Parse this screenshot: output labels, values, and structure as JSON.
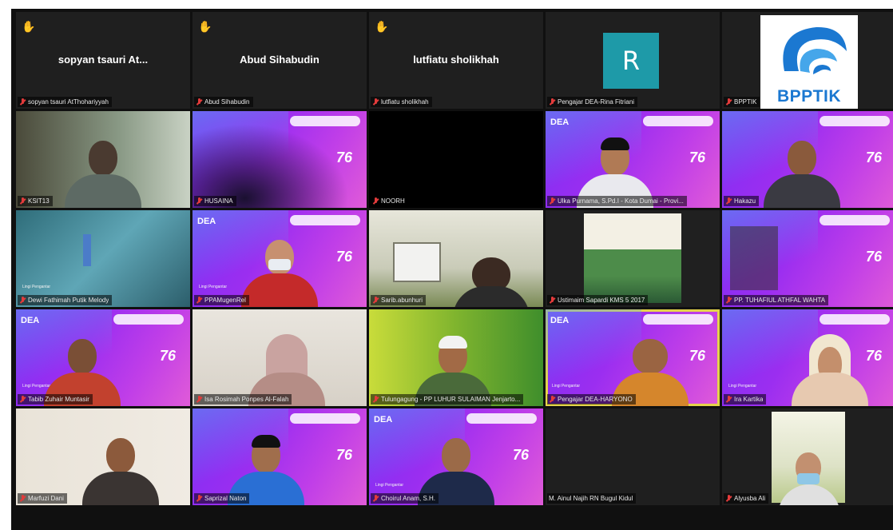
{
  "top_tiles": [
    {
      "display_name": "sopyan tsauri At...",
      "bar_name": "sopyan tsauri AtThohariyyah"
    },
    {
      "display_name": "Abud Sihabudin",
      "bar_name": "Abud Sihabudin"
    },
    {
      "display_name": "lutfiatu sholikhah",
      "bar_name": "lutfiatu sholikhah"
    },
    {
      "avatar_letter": "R",
      "bar_name": "Pengajar DEA-Rina Fitriani"
    },
    {
      "logo_text": "BPPTIK",
      "bar_name": "BPPTIK"
    }
  ],
  "tiles": [
    {
      "bar_name": "KSIT13"
    },
    {
      "bar_name": "HUSAINA"
    },
    {
      "bar_name": "NOORH"
    },
    {
      "bar_name": "Ulka Purnama, S.Pd.I - Kota Dumai - Provi..."
    },
    {
      "bar_name": "Hakazu"
    },
    {
      "bar_name": "Dewi Fathimah Putik Melody"
    },
    {
      "bar_name": "PPAMugenRel"
    },
    {
      "bar_name": "Sarib.abunhuri"
    },
    {
      "bar_name": "Ustimaim Sapardi KMS 5 2017"
    },
    {
      "bar_name": "PP. TUHAFIUL ATHFAL WAHTA"
    },
    {
      "bar_name": "Tabib Zuhair Muntasir"
    },
    {
      "bar_name": "Isa Rosimah Ponpes Al-Falah"
    },
    {
      "bar_name": "Tulungagung - PP LUHUR SULAIMAN Jenjarto..."
    },
    {
      "bar_name": "Pengajar DEA-HARYONO"
    },
    {
      "bar_name": "Ira Kartika"
    },
    {
      "bar_name": "Marfuzi Dani"
    },
    {
      "bar_name": "Saprizal Naton"
    },
    {
      "bar_name": "Choirul Anam, S.H."
    },
    {
      "bar_name": "M. Ainul Najih RN Bugul Kidul"
    },
    {
      "bar_name": "Alyusba Ali"
    }
  ],
  "virtual_bg": {
    "brand": "DEA",
    "number": "76",
    "caption": "Lingi Pengantar"
  },
  "icons": {
    "raised_hand": "raised-hand-icon",
    "muted_mic": "muted-mic-icon"
  },
  "colors": {
    "active_speaker_border": "#e4d34a",
    "avatar_bg": "#1e9aa8",
    "logo_blue": "#1b78d1"
  }
}
